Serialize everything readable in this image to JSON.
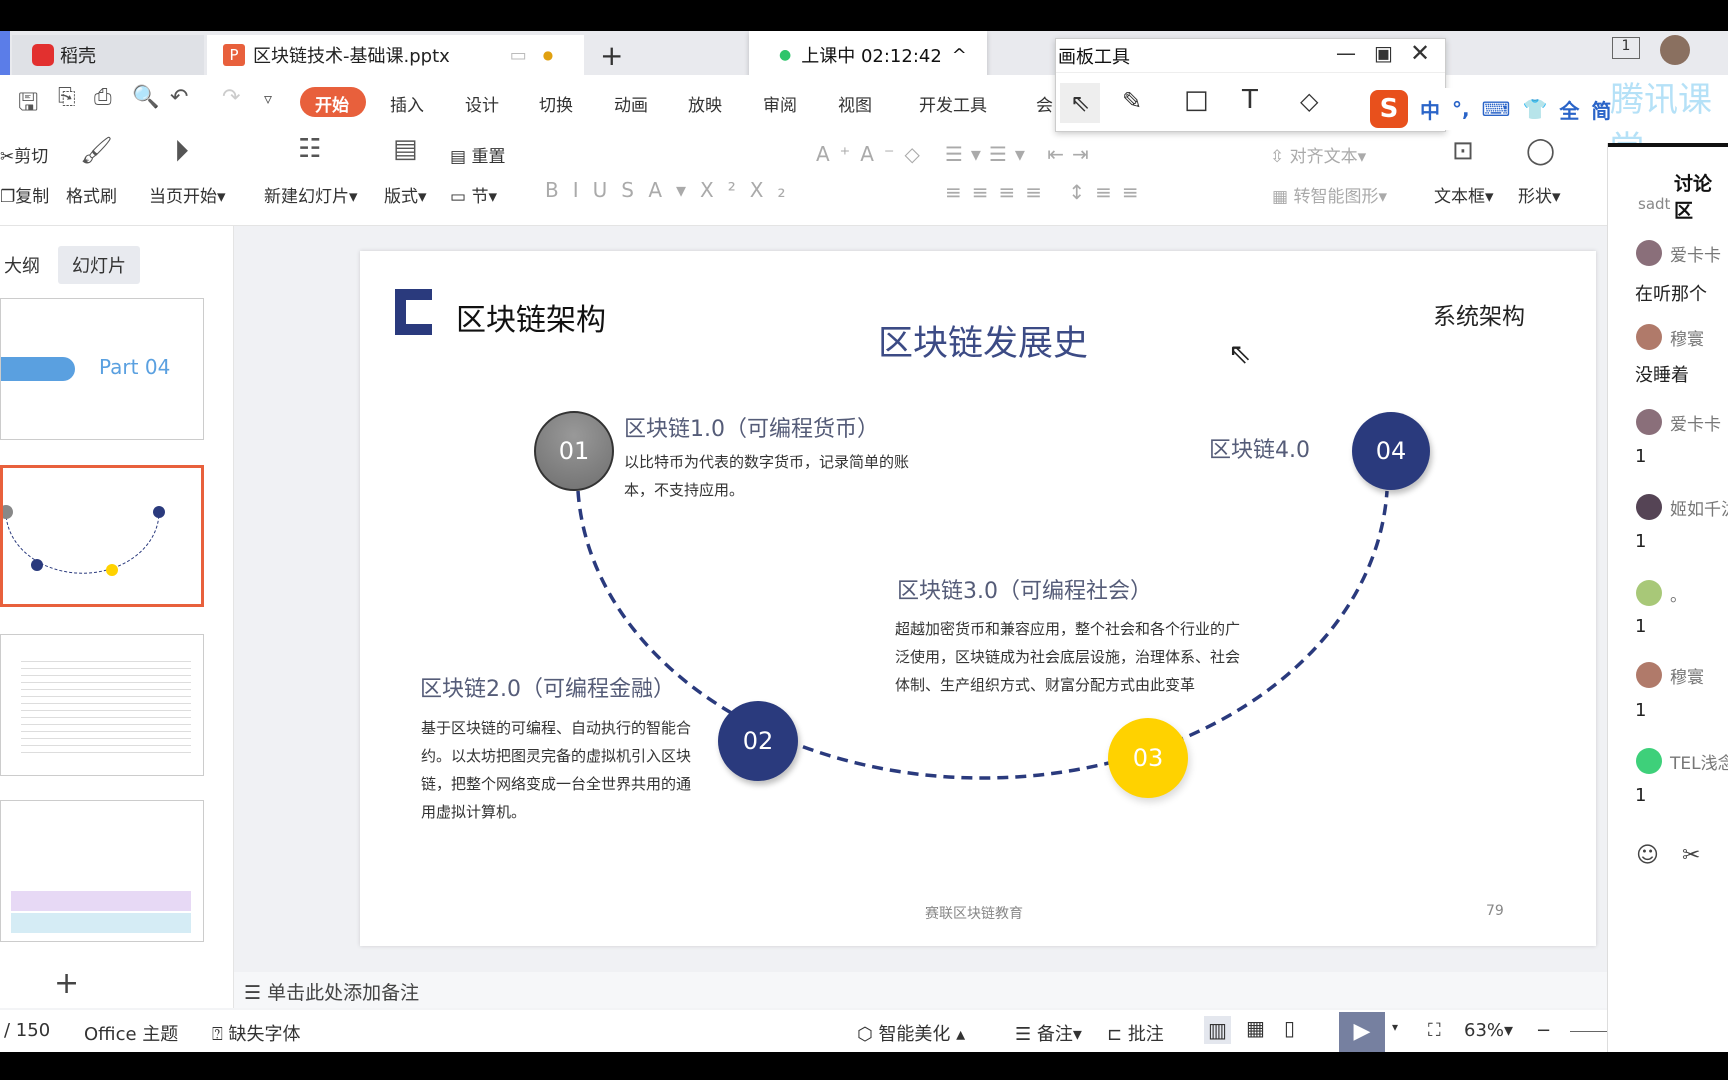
{
  "tabs": {
    "home": "稻壳",
    "doc": "区块链技术-基础课.pptx",
    "new_tab": "+"
  },
  "class_status": {
    "label": "上课中 02:12:42",
    "chevron": "^"
  },
  "board_tool": {
    "title": "画板工具",
    "tools": [
      "select-icon",
      "pen-icon",
      "rectangle-icon",
      "text-icon",
      "eraser-icon"
    ]
  },
  "ime": {
    "items": [
      "中",
      "°,",
      "⌨",
      "👕",
      "全",
      "简"
    ]
  },
  "watermark": "腾讯课堂",
  "menu": {
    "items": [
      "开始",
      "插入",
      "设计",
      "切换",
      "动画",
      "放映",
      "审阅",
      "视图",
      "开发工具",
      "会"
    ],
    "active": "开始"
  },
  "ribbon": {
    "cut": "剪切",
    "copy": "复制",
    "format_painter": "格式刷",
    "play_from": "当页开始",
    "new_slide": "新建幻灯片",
    "layout": "版式",
    "reset": "重置",
    "section": "节",
    "align_text": "对齐文本",
    "smart_shape": "转智能图形",
    "textbox": "文本框",
    "shape": "形状"
  },
  "left_panel": {
    "tabs": [
      "大纲",
      "幻灯片"
    ],
    "active": "幻灯片",
    "add": "+",
    "thumb1_text": "Part 04"
  },
  "slide": {
    "header": "区块链架构",
    "corner": "系统架构",
    "title": "区块链发展史",
    "accent": "#2a3a7d",
    "yellow": "#ffd200",
    "stages": [
      {
        "num": "01",
        "title": "区块链1.0（可编程货币）",
        "body": [
          "以比特币为代表的数字货币，记录简单的账",
          "本，不支持应用。"
        ]
      },
      {
        "num": "02",
        "title": "区块链2.0（可编程金融）",
        "body": [
          "基于区块链的可编程、自动执行的智能合",
          "约。以太坊把图灵完备的虚拟机引入区块",
          "链，把整个网络变成一台全世界共用的通",
          "用虚拟计算机。"
        ]
      },
      {
        "num": "03",
        "title": "区块链3.0（可编程社会）",
        "body": [
          "超越加密货币和兼容应用，整个社会和各个行业的广",
          "泛使用，区块链成为社会底层设施，治理体系、社会",
          "体制、生产组织方式、财富分配方式由此变革"
        ]
      },
      {
        "num": "04",
        "title": "区块链4.0",
        "body": []
      }
    ],
    "footer": "赛联区块链教育",
    "page": "79"
  },
  "notes_placeholder": "单击此处添加备注",
  "status": {
    "slide_count": "/ 150",
    "theme": "Office 主题",
    "missing_font": "缺失字体",
    "beautify": "智能美化",
    "notes": "备注",
    "comment": "批注",
    "zoom": "63%"
  },
  "chat": {
    "title": "讨论区",
    "partial": "sadt",
    "messages": [
      {
        "name": "爱卡卡",
        "text": "在听那个"
      },
      {
        "name": "穆寰",
        "text": "没睡着"
      },
      {
        "name": "爱卡卡",
        "text": "1"
      },
      {
        "name": "姬如千泷",
        "text": "1"
      },
      {
        "name": "。",
        "text": "1"
      },
      {
        "name": "穆寰",
        "text": "1"
      },
      {
        "name": "TEL浅念",
        "text": "1"
      }
    ]
  }
}
